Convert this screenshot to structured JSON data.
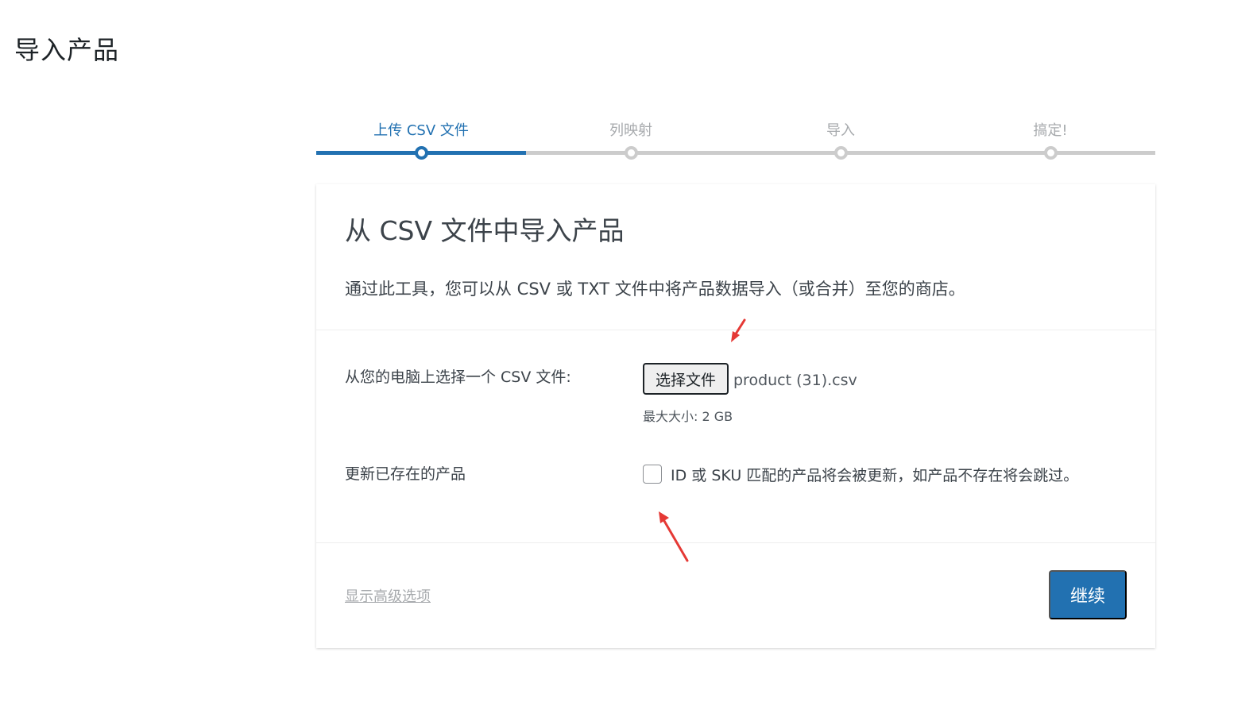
{
  "page": {
    "title": "导入产品"
  },
  "steps": [
    {
      "label": "上传 CSV 文件",
      "active": true
    },
    {
      "label": "列映射",
      "active": false
    },
    {
      "label": "导入",
      "active": false
    },
    {
      "label": "搞定!",
      "active": false
    }
  ],
  "card": {
    "title": "从 CSV 文件中导入产品",
    "description": "通过此工具，您可以从 CSV 或 TXT 文件中将产品数据导入（或合并）至您的商店。",
    "file_row": {
      "label": "从您的电脑上选择一个 CSV 文件:",
      "button_label": "选择文件",
      "file_name": "product (31).csv",
      "max_size": "最大大小: 2 GB"
    },
    "update_row": {
      "label": "更新已存在的产品",
      "checkbox_label": "ID 或 SKU 匹配的产品将会被更新，如产品不存在将会跳过。",
      "checked": false
    },
    "advanced_link": "显示高级选项",
    "continue_button": "继续"
  },
  "colors": {
    "accent": "#2271b1",
    "annotation_arrow": "#e53935"
  }
}
